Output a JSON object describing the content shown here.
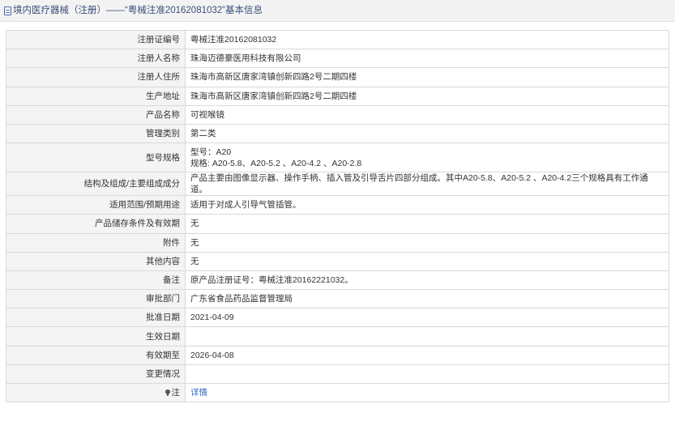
{
  "header": {
    "icon": "document-icon",
    "title": "境内医疗器械（注册）——“粤械注准20162081032”基本信息"
  },
  "rows": [
    {
      "label": "注册证编号",
      "value": "粤械注准20162081032"
    },
    {
      "label": "注册人名称",
      "value": "珠海迈德豪医用科技有限公司"
    },
    {
      "label": "注册人住所",
      "value": "珠海市高新区唐家湾镇创新四路2号二期四楼"
    },
    {
      "label": "生产地址",
      "value": "珠海市高新区唐家湾镇创新四路2号二期四楼"
    },
    {
      "label": "产品名称",
      "value": "可视喉镜"
    },
    {
      "label": "管理类别",
      "value": "第二类"
    },
    {
      "label": "型号规格",
      "value_line1": "型号：A20",
      "value_line2": "规格: A20-5.8、A20-5.2 、A20-4.2 、A20-2.8"
    },
    {
      "label": "结构及组成/主要组成成分",
      "value": "产品主要由图像显示器、操作手柄、插入管及引导舌片四部分组成。其中A20-5.8、A20-5.2 、A20-4.2三个规格具有工作通道。"
    },
    {
      "label": "适用范围/预期用途",
      "value": "适用于对成人引导气管插管。"
    },
    {
      "label": "产品储存条件及有效期",
      "value": "无"
    },
    {
      "label": "附件",
      "value": "无"
    },
    {
      "label": "其他内容",
      "value": "无"
    },
    {
      "label": "备注",
      "value": "原产品注册证号：粤械注准20162221032。"
    },
    {
      "label": "审批部门",
      "value": "广东省食品药品监督管理局"
    },
    {
      "label": "批准日期",
      "value": "2021-04-09"
    },
    {
      "label": "生效日期",
      "value": ""
    },
    {
      "label": "有效期至",
      "value": "2026-04-08"
    },
    {
      "label": "变更情况",
      "value": ""
    },
    {
      "label": "注",
      "label_icon": "bulb-icon",
      "value": "详情"
    }
  ],
  "colors": {
    "header_bg": "#f3f3f3",
    "header_text": "#3a4f7a",
    "label_bg": "#f4f4f4",
    "border": "#d9d9d9",
    "link": "#3366cc"
  }
}
